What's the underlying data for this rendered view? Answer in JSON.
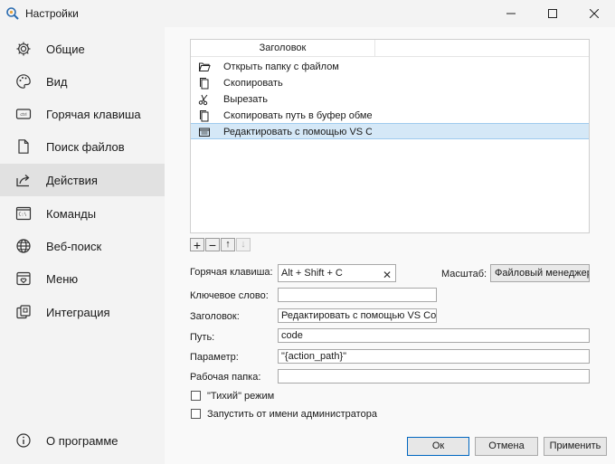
{
  "window": {
    "title": "Настройки",
    "icon": "search-gear-icon"
  },
  "sidebar": {
    "items": [
      {
        "label": "Общие",
        "icon": "gear-icon"
      },
      {
        "label": "Вид",
        "icon": "palette-icon"
      },
      {
        "label": "Горячая клавиша",
        "icon": "keyboard-key-icon"
      },
      {
        "label": "Поиск файлов",
        "icon": "document-icon"
      },
      {
        "label": "Действия",
        "icon": "share-arrow-icon",
        "active": true
      },
      {
        "label": "Команды",
        "icon": "terminal-icon"
      },
      {
        "label": "Веб-поиск",
        "icon": "globe-icon"
      },
      {
        "label": "Меню",
        "icon": "menu-heart-icon"
      },
      {
        "label": "Интеграция",
        "icon": "integration-icon"
      }
    ],
    "about": {
      "label": "О программе",
      "icon": "info-icon"
    }
  },
  "actions_list": {
    "header": "Заголовок",
    "rows": [
      {
        "label": "Открыть папку с файлом",
        "icon": "folder-open-icon"
      },
      {
        "label": "Скопировать",
        "icon": "copy-icon"
      },
      {
        "label": "Вырезать",
        "icon": "scissors-icon"
      },
      {
        "label": "Скопировать путь в буфер обмена",
        "icon": "copy-icon"
      },
      {
        "label": "Редактировать с помощью VS Code",
        "icon": "edit-window-icon",
        "selected": true
      }
    ]
  },
  "toolbar": {
    "add": "+",
    "remove": "−",
    "up": "↑",
    "down": "↓"
  },
  "form": {
    "hotkey_label": "Горячая клавиша:",
    "hotkey_value": "Alt + Shift + C",
    "hotkey_clear": "✕",
    "scale_label": "Масштаб:",
    "scale_value": "Файловый менеджер",
    "keyword_label": "Ключевое слово:",
    "keyword_value": "",
    "title_label": "Заголовок:",
    "title_value": "Редактировать с помощью VS Code",
    "path_label": "Путь:",
    "path_value": "code",
    "param_label": "Параметр:",
    "param_value": "\"{action_path}\"",
    "workdir_label": "Рабочая папка:",
    "workdir_value": "",
    "quiet_label": "\"Тихий\" режим",
    "quiet_checked": false,
    "admin_label": "Запустить от имени администратора",
    "admin_checked": false
  },
  "buttons": {
    "ok": "Ок",
    "cancel": "Отмена",
    "apply": "Применить"
  },
  "colors": {
    "accent": "#0067c0",
    "selection": "#d5e8f7"
  }
}
